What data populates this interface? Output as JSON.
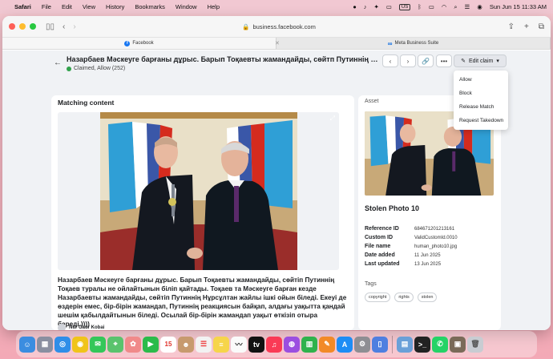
{
  "menubar": {
    "app": "Safari",
    "items": [
      "File",
      "Edit",
      "View",
      "History",
      "Bookmarks",
      "Window",
      "Help"
    ],
    "input_source": "US",
    "datetime": "Sun Jun 15  11:33 AM"
  },
  "browser": {
    "address": "business.facebook.com",
    "tabs": [
      {
        "label": "Facebook",
        "active": true
      },
      {
        "label": "Meta Business Suite",
        "active": false
      }
    ]
  },
  "header": {
    "title": "Назарбаев Мәскеуге барғаны дұрыс. Барып Тоқаевты жамандайды, сөйтп Путиннің Тоқаев туралы ...",
    "status": "Claimed, Allow (252)",
    "edit_label": "Edit claim"
  },
  "dropdown": {
    "items": [
      "Allow",
      "Block",
      "Release Match",
      "Request Takedown"
    ]
  },
  "matching": {
    "heading": "Matching content",
    "description": "Назарбаев Мәскеуге барғаны дұрыс. Барып Тоқаевты жамандайды, сөйтіп Путиннің Тоқаев туралы не ойлайтынын біліп қайтады. Тоқаев та Мәскеуге барған кезде Назарбаевты жамандайды, сөйтіп Путиннің Нұрсұлтан жайлы ішкі ойын біледі. Екеуі де өздерін емес, бір-бірін жамандап, Путиннің реакциясын байқап, алдағы уақытта қандай шешім қабылдайтынын біледі. Осылай бір-бірін жамандап уақыт өткізіп отыра береді.))))",
    "author": "Nur Gaur Kobai"
  },
  "asset": {
    "heading": "Asset",
    "title": "Stolen Photo 10",
    "fields": [
      {
        "key": "Reference ID",
        "value": "684671201213161"
      },
      {
        "key": "Custom ID",
        "value": "ValidCustomId.0010"
      },
      {
        "key": "File name",
        "value": "human_photo10.jpg"
      },
      {
        "key": "Date added",
        "value": "11 Jun 2025"
      },
      {
        "key": "Last updated",
        "value": "13 Jun 2025"
      }
    ],
    "tags_heading": "Tags",
    "tags": [
      "copyright",
      "rights",
      "stolen"
    ]
  },
  "dock": {
    "calendar_day": "15",
    "apps": [
      "finder",
      "launchpad",
      "safari",
      "chrome",
      "messages",
      "maps",
      "photos",
      "facetime",
      "calendar",
      "contacts",
      "reminders",
      "notes",
      "freeform",
      "appletv",
      "music",
      "podcasts",
      "numbers",
      "pages",
      "appstore",
      "settings",
      "iphone-mirroring",
      "preview",
      "terminal",
      "whatsapp",
      "trash"
    ]
  },
  "colors": {
    "accent": "#1877f2",
    "status_green": "#31a24c",
    "flag_blue": "#2f9fd6",
    "flag_russia_red": "#d52b1e"
  }
}
